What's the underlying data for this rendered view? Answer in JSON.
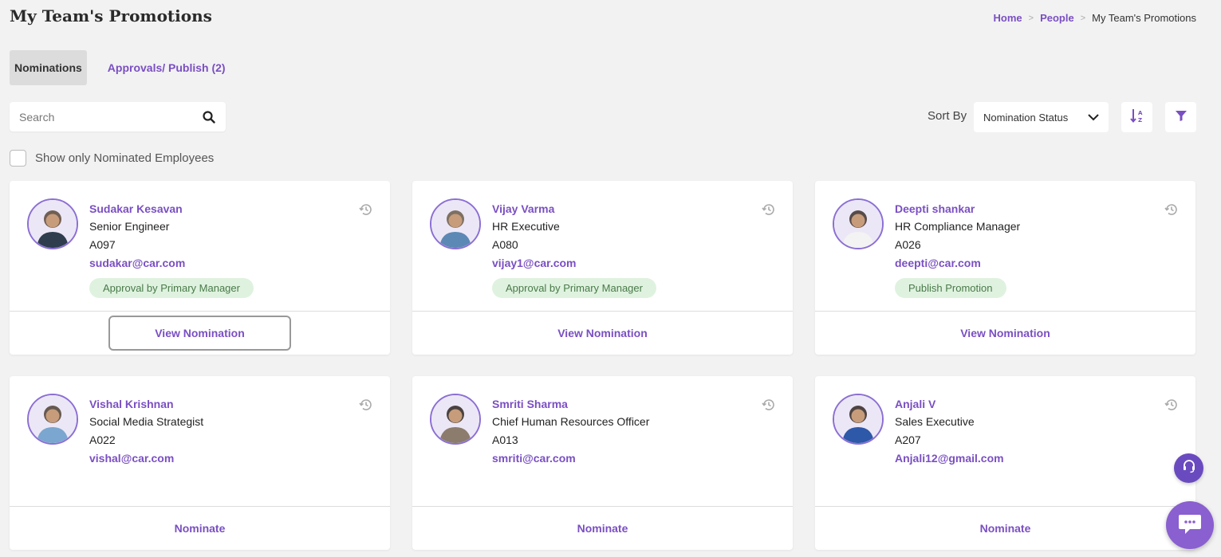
{
  "page": {
    "title": "My Team's Promotions"
  },
  "breadcrumb": {
    "home": "Home",
    "people": "People",
    "current": "My Team's Promotions",
    "separator": ">"
  },
  "tabs": {
    "nominations": "Nominations",
    "approvals": "Approvals/ Publish (2)"
  },
  "search": {
    "placeholder": "Search",
    "icon": "search-icon"
  },
  "sort": {
    "label": "Sort By",
    "value": "Nomination Status",
    "icons": [
      "sort-alpha-icon",
      "filter-icon"
    ]
  },
  "filter_checkbox": {
    "label": "Show only Nominated Employees",
    "checked": false
  },
  "employees": [
    {
      "name": "Sudakar Kesavan",
      "role": "Senior Engineer",
      "code": "A097",
      "email": "sudakar@car.com",
      "status": "Approval by Primary Manager",
      "action": "View Nomination",
      "focused": true
    },
    {
      "name": "Vijay Varma",
      "role": "HR Executive",
      "code": "A080",
      "email": "vijay1@car.com",
      "status": "Approval by Primary Manager",
      "action": "View Nomination",
      "focused": false
    },
    {
      "name": "Deepti shankar",
      "role": "HR Compliance Manager",
      "code": "A026",
      "email": "deepti@car.com",
      "status": "Publish Promotion",
      "action": "View Nomination",
      "focused": false
    },
    {
      "name": "Vishal Krishnan",
      "role": "Social Media Strategist",
      "code": "A022",
      "email": "vishal@car.com",
      "status": "",
      "action": "Nominate",
      "focused": false
    },
    {
      "name": "Smriti Sharma",
      "role": "Chief Human Resources Officer",
      "code": "A013",
      "email": "smriti@car.com",
      "status": "",
      "action": "Nominate",
      "focused": false
    },
    {
      "name": "Anjali V",
      "role": "Sales Executive",
      "code": "A207",
      "email": "Anjali12@gmail.com",
      "status": "",
      "action": "Nominate",
      "focused": false
    }
  ],
  "colors": {
    "accent": "#7a4fc2",
    "status_bg": "#dff2df",
    "status_text": "#4a7a4a",
    "chat_button": "#8a5fd0",
    "support_button": "#6a4bbf"
  }
}
